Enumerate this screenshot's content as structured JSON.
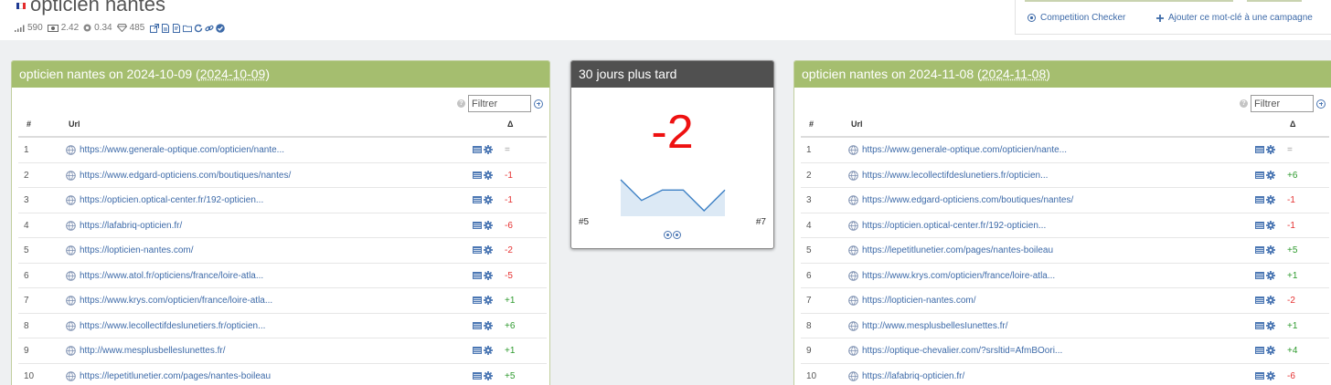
{
  "header": {
    "keyword": "opticien nantes",
    "flag_colors": [
      "#1f3a93",
      "#ffffff",
      "#e32c2c"
    ],
    "metrics": {
      "volume": "590",
      "cpc": "2.42",
      "competition": "0.34",
      "value": "485"
    },
    "tool_icons": [
      "external-link-icon",
      "file-icon",
      "pdf-icon",
      "folder-icon",
      "refresh-icon",
      "link-icon",
      "check-circle-icon"
    ]
  },
  "actions": {
    "competition_checker": "Competition Checker",
    "add_to_campaign": "Ajouter ce mot-clé à une campagne"
  },
  "left_panel": {
    "title_prefix": "opticien nantes on 2024-10-09 (",
    "title_date": "2024-10-09",
    "title_suffix": ")",
    "filter_placeholder": "Filtrer",
    "col_num": "#",
    "col_url": "Url",
    "col_delta": "Δ",
    "rows": [
      {
        "num": "1",
        "url": "https://www.generale-optique.com/opticien/nante...",
        "delta": "=",
        "trend": "neu"
      },
      {
        "num": "2",
        "url": "https://www.edgard-opticiens.com/boutiques/nantes/",
        "delta": "-1",
        "trend": "neg"
      },
      {
        "num": "3",
        "url": "https://opticien.optical-center.fr/192-opticien...",
        "delta": "-1",
        "trend": "neg"
      },
      {
        "num": "4",
        "url": "https://lafabriq-opticien.fr/",
        "delta": "-6",
        "trend": "neg"
      },
      {
        "num": "5",
        "url": "https://lopticien-nantes.com/",
        "delta": "-2",
        "trend": "neg"
      },
      {
        "num": "6",
        "url": "https://www.atol.fr/opticiens/france/loire-atla...",
        "delta": "-5",
        "trend": "neg"
      },
      {
        "num": "7",
        "url": "https://www.krys.com/opticien/france/loire-atla...",
        "delta": "+1",
        "trend": "pos"
      },
      {
        "num": "8",
        "url": "https://www.lecollectifdeslunetiers.fr/opticien...",
        "delta": "+6",
        "trend": "pos"
      },
      {
        "num": "9",
        "url": "http://www.mesplusbellesIunettes.fr/",
        "delta": "+1",
        "trend": "pos"
      },
      {
        "num": "10",
        "url": "https://lepetitlunetier.com/pages/nantes-boileau",
        "delta": "+5",
        "trend": "pos"
      }
    ]
  },
  "middle_panel": {
    "title": "30 jours plus tard",
    "delta": "-2",
    "start_label": "#5",
    "end_label": "#7",
    "sparkline_positions": [
      5,
      7,
      6,
      6,
      8,
      6
    ],
    "line_color": "#3b7fc4",
    "fill_color": "#dce9f5"
  },
  "right_panel": {
    "title_prefix": "opticien nantes on 2024-11-08 (",
    "title_date": "2024-11-08",
    "title_suffix": ")",
    "filter_placeholder": "Filtrer",
    "col_num": "#",
    "col_url": "Url",
    "col_delta": "Δ",
    "rows": [
      {
        "num": "1",
        "url": "https://www.generale-optique.com/opticien/nante...",
        "delta": "=",
        "trend": "neu"
      },
      {
        "num": "2",
        "url": "https://www.lecollectifdeslunetiers.fr/opticien...",
        "delta": "+6",
        "trend": "pos"
      },
      {
        "num": "3",
        "url": "https://www.edgard-opticiens.com/boutiques/nantes/",
        "delta": "-1",
        "trend": "neg"
      },
      {
        "num": "4",
        "url": "https://opticien.optical-center.fr/192-opticien...",
        "delta": "-1",
        "trend": "neg"
      },
      {
        "num": "5",
        "url": "https://lepetitlunetier.com/pages/nantes-boileau",
        "delta": "+5",
        "trend": "pos"
      },
      {
        "num": "6",
        "url": "https://www.krys.com/opticien/france/loire-atla...",
        "delta": "+1",
        "trend": "pos"
      },
      {
        "num": "7",
        "url": "https://lopticien-nantes.com/",
        "delta": "-2",
        "trend": "neg"
      },
      {
        "num": "8",
        "url": "http://www.mesplusbellesIunettes.fr/",
        "delta": "+1",
        "trend": "pos"
      },
      {
        "num": "9",
        "url": "https://optique-chevalier.com/?srsltid=AfmBOori...",
        "delta": "+4",
        "trend": "pos"
      },
      {
        "num": "10",
        "url": "https://lafabriq-opticien.fr/",
        "delta": "-6",
        "trend": "neg"
      }
    ]
  }
}
